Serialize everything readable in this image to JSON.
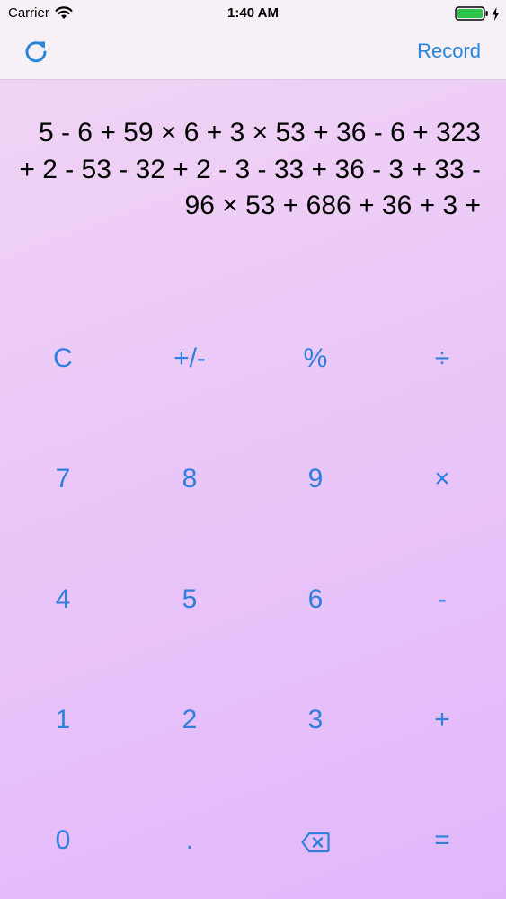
{
  "status_bar": {
    "carrier": "Carrier",
    "time": "1:40 AM"
  },
  "nav": {
    "left_icon": "refresh-icon",
    "record_label": "Record"
  },
  "display": {
    "expression": "5 - 6 + 59 × 6 + 3 × 53 + 36 - 6 + 323 + 2 - 53 - 32 + 2 - 3 - 33 + 36 - 3 + 33 - 96 × 53 + 686 + 36 + 3 +"
  },
  "keypad": {
    "row1": [
      "C",
      "+/-",
      "%",
      "÷"
    ],
    "row2": [
      "7",
      "8",
      "9",
      "×"
    ],
    "row3": [
      "4",
      "5",
      "6",
      "-"
    ],
    "row4": [
      "1",
      "2",
      "3",
      "+"
    ],
    "row5": [
      "0",
      ".",
      "",
      "="
    ],
    "backspace_icon": "backspace-icon"
  },
  "colors": {
    "accent": "#2f7fde",
    "background_top": "#f1d6f3",
    "background_bottom": "#e1b7fb"
  }
}
